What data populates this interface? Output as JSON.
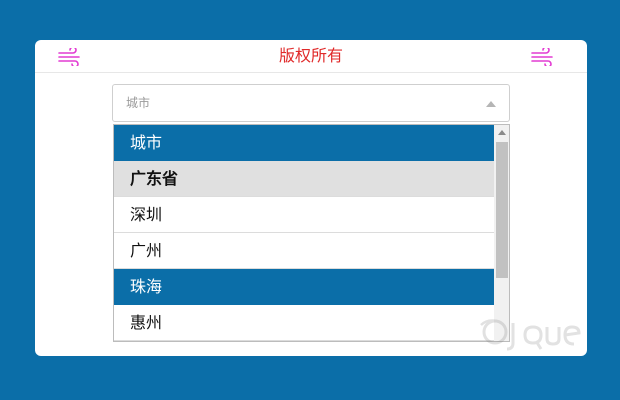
{
  "header": {
    "title": "版权所有",
    "left_icon": "wind-icon",
    "right_icon": "wind-icon",
    "title_color": "#e02a2a",
    "icon_color": "#e23bd2"
  },
  "select": {
    "value": "城市"
  },
  "dropdown": {
    "options": [
      {
        "label": "城市",
        "state": "selected"
      },
      {
        "label": "广东省",
        "state": "group"
      },
      {
        "label": "深圳",
        "state": "normal"
      },
      {
        "label": "广州",
        "state": "normal"
      },
      {
        "label": "珠海",
        "state": "hover"
      },
      {
        "label": "惠州",
        "state": "normal"
      }
    ]
  },
  "colors": {
    "background": "#0b6ea8",
    "highlight": "#0b6ea8",
    "group_bg": "#e0e0e0"
  }
}
